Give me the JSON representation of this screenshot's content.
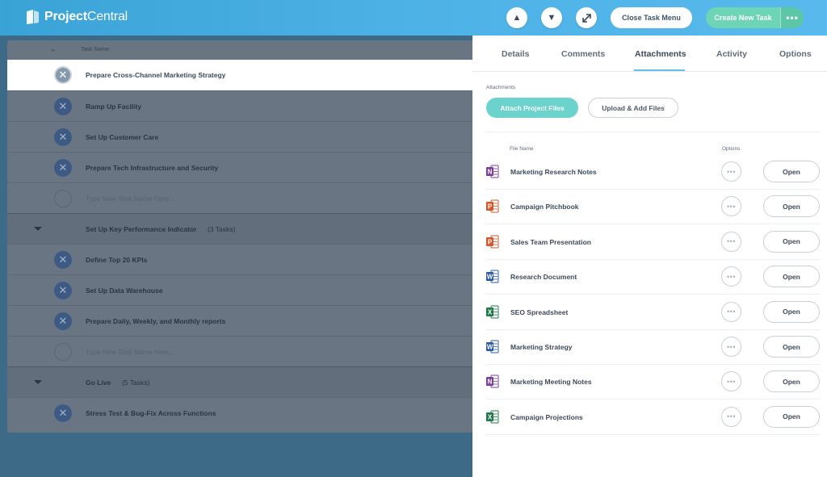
{
  "app": {
    "brand_left": "Project",
    "brand_right": "Central"
  },
  "header": {
    "up_icon": "triangle-up-icon",
    "down_icon": "triangle-down-icon",
    "expand_icon": "expand-arrows-icon",
    "close_menu_label": "Close Task Menu",
    "create_task_label": "Create New Task",
    "more_label": "•••"
  },
  "task_list": {
    "column_header": "Task Name",
    "rows": [
      {
        "type": "task",
        "name": "Prepare Cross-Channel Marketing Strategy",
        "selected": true
      },
      {
        "type": "task",
        "name": "Ramp Up Facility"
      },
      {
        "type": "task",
        "name": "Set Up Customer Care"
      },
      {
        "type": "task",
        "name": "Prepare Tech Infrastructure and Security"
      },
      {
        "type": "placeholder",
        "name": "Type New Task Name Here..."
      },
      {
        "type": "group",
        "name": "Set Up Key Performance Indicator",
        "count": "(3 Tasks)"
      },
      {
        "type": "task",
        "name": "Define Top 20 KPIs"
      },
      {
        "type": "task",
        "name": "Set Up Data Warehouse"
      },
      {
        "type": "task",
        "name": "Prepare Daily, Weekly, and Monthly reports"
      },
      {
        "type": "placeholder",
        "name": "Type New Task Name Here..."
      },
      {
        "type": "group",
        "name": "Go Live",
        "count": "(5 Tasks)"
      },
      {
        "type": "task",
        "name": "Stress Test & Bug-Fix Across Functions"
      }
    ]
  },
  "panel": {
    "tabs": [
      {
        "label": "Details"
      },
      {
        "label": "Comments"
      },
      {
        "label": "Attachments",
        "active": true
      },
      {
        "label": "Activity"
      },
      {
        "label": "Options"
      }
    ],
    "attachments_label": "Attachments",
    "attach_button": "Attach Project Files",
    "upload_button": "Upload & Add Files",
    "col_file_name": "File Name",
    "col_options": "Options",
    "open_label": "Open",
    "files": [
      {
        "name": "Marketing Research Notes",
        "type": "onenote",
        "letter": "N",
        "color": "#7b3f99"
      },
      {
        "name": "Campaign Pitchbook",
        "type": "powerpoint",
        "letter": "P",
        "color": "#d2572d"
      },
      {
        "name": "Sales Team Presentation",
        "type": "powerpoint",
        "letter": "P",
        "color": "#d2572d"
      },
      {
        "name": "Research Document",
        "type": "word",
        "letter": "W",
        "color": "#2b5ba8"
      },
      {
        "name": "SEO Spreadsheet",
        "type": "excel",
        "letter": "X",
        "color": "#21794a"
      },
      {
        "name": "Marketing Strategy",
        "type": "word",
        "letter": "W",
        "color": "#2b5ba8"
      },
      {
        "name": "Marketing Meeting Notes",
        "type": "onenote",
        "letter": "N",
        "color": "#7b3f99"
      },
      {
        "name": "Campaign Projections",
        "type": "excel",
        "letter": "X",
        "color": "#21794a"
      }
    ]
  }
}
